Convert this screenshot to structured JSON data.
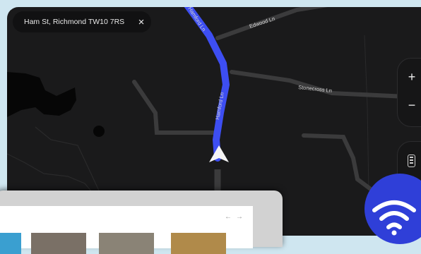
{
  "search": {
    "address": "Ham St, Richmond TW10 7RS",
    "close_icon": "×"
  },
  "map": {
    "roads": {
      "top_route": "Hamford Ln",
      "route": "Hamford Ln",
      "edwood": "Edwood Ln",
      "stonecross": "Stonecross Ln"
    },
    "route_color": "#3d4ef2"
  },
  "controls": {
    "zoom_in": "+",
    "zoom_out": "−"
  },
  "laptop": {
    "back_arrow": "←",
    "forward_arrow": "→"
  },
  "icons": {
    "close": "close-icon",
    "nav_arrow": "navigation-arrow-icon",
    "battery": "battery-icon",
    "bolt": "lightning-bolt-icon",
    "wifi": "wifi-icon"
  }
}
